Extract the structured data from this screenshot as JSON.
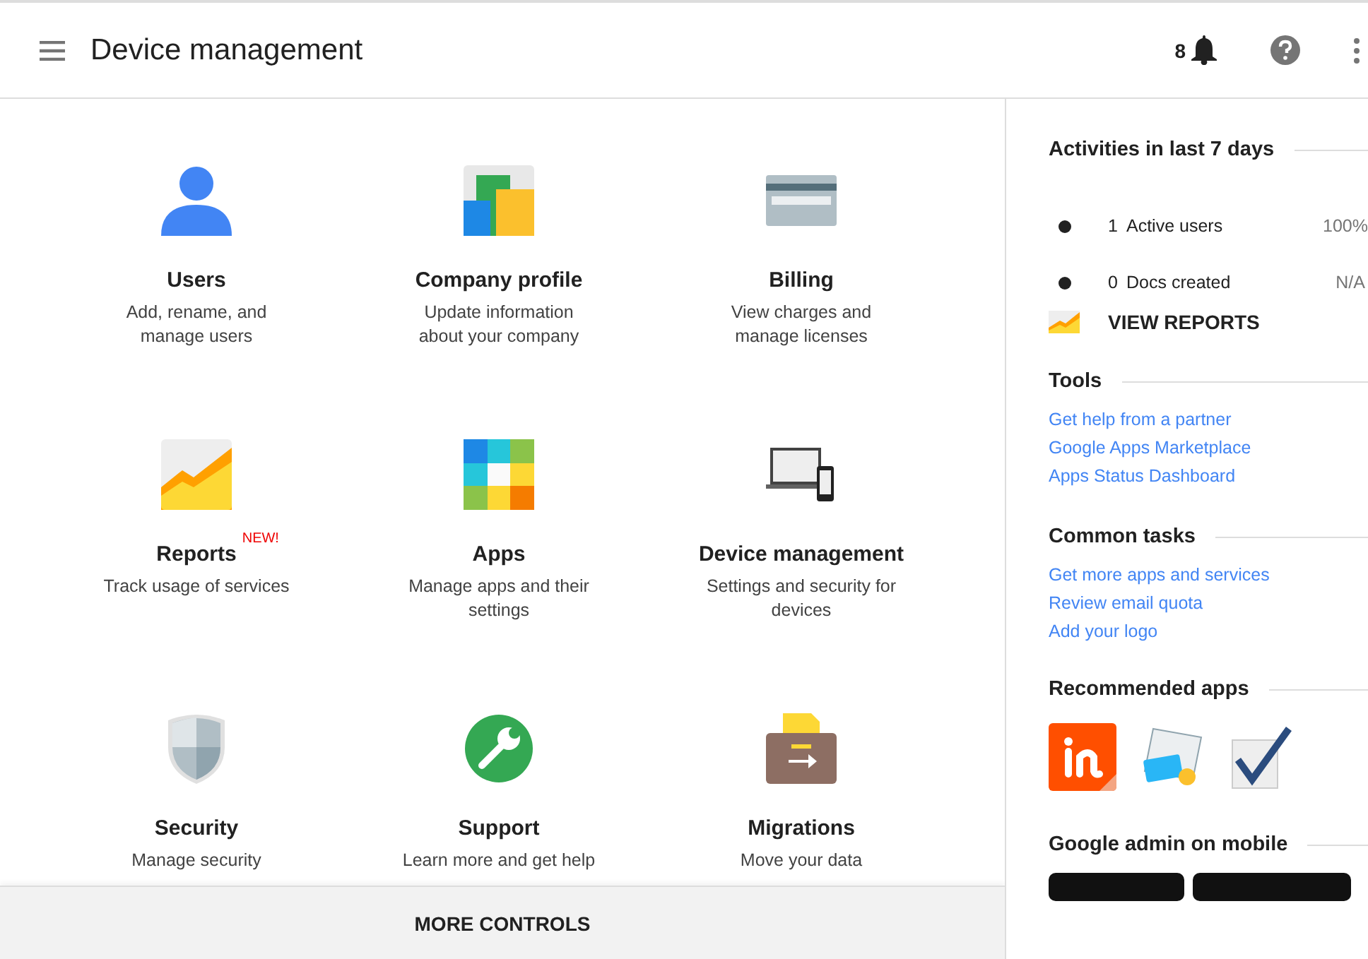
{
  "header": {
    "title": "Device management",
    "notification_count": "8"
  },
  "cards": [
    {
      "title": "Users",
      "description": "Add, rename, and manage users"
    },
    {
      "title": "Company profile",
      "description": "Update information about your company"
    },
    {
      "title": "Billing",
      "description": "View charges and manage licenses"
    },
    {
      "title": "Reports",
      "badge": "NEW!",
      "description": "Track usage of services"
    },
    {
      "title": "Apps",
      "description": "Manage apps and their settings"
    },
    {
      "title": "Device management",
      "description": "Settings and security for devices"
    },
    {
      "title": "Security",
      "description": "Manage security"
    },
    {
      "title": "Support",
      "description": "Learn more and get help"
    },
    {
      "title": "Migrations",
      "description": "Move your data"
    }
  ],
  "more_controls": "MORE CONTROLS",
  "sidebar": {
    "activities": {
      "title": "Activities in last 7 days",
      "stats": [
        {
          "count": "1",
          "label": "Active users",
          "value": "100%"
        },
        {
          "count": "0",
          "label": "Docs created",
          "value": "N/A"
        }
      ],
      "view_reports": "VIEW REPORTS"
    },
    "tools": {
      "title": "Tools",
      "links": [
        "Get help from a partner",
        "Google Apps Marketplace",
        "Apps Status Dashboard"
      ]
    },
    "common_tasks": {
      "title": "Common tasks",
      "links": [
        "Get more apps and services",
        "Review email quota",
        "Add your logo"
      ]
    },
    "recommended_apps": {
      "title": "Recommended apps"
    },
    "mobile": {
      "title": "Google admin on mobile"
    }
  }
}
